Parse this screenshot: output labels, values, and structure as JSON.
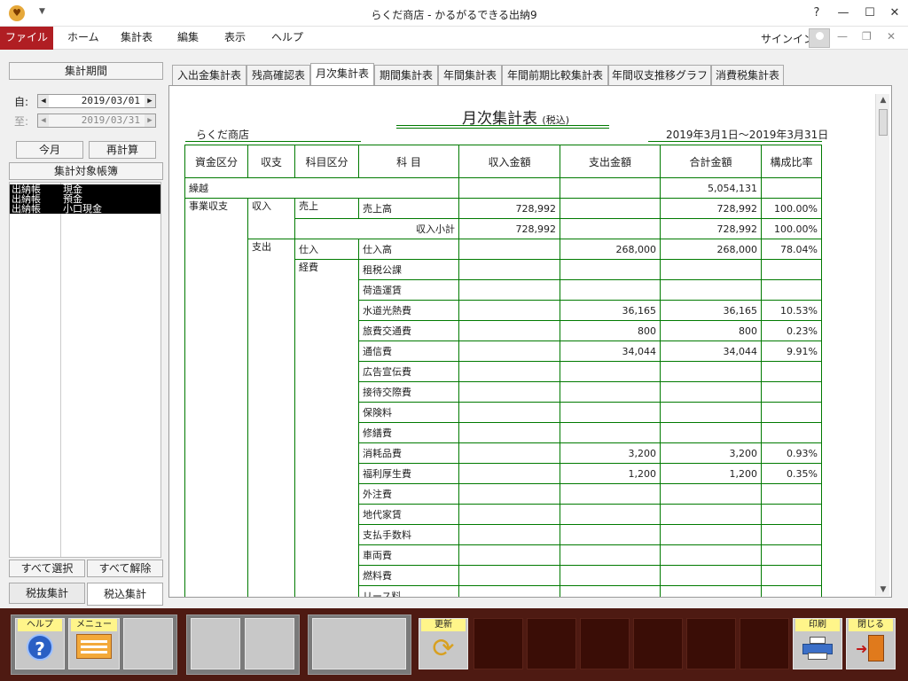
{
  "window": {
    "title": "らくだ商店 - かるがるできる出納9",
    "help_glyph": "?"
  },
  "menu": {
    "items": [
      "ファイル",
      "ホーム",
      "集計表",
      "編集",
      "表示",
      "ヘルプ"
    ],
    "signin": "サインイン"
  },
  "left": {
    "period_header": "集計期間",
    "from_label": "自:",
    "from_date": "2019/03/01",
    "to_label": "至:",
    "to_date": "2019/03/31",
    "this_month": "今月",
    "recalc": "再計算",
    "ledger_header": "集計対象帳簿",
    "ledgers": [
      {
        "book": "出納帳",
        "account": "現金"
      },
      {
        "book": "出納帳",
        "account": "預金"
      },
      {
        "book": "出納帳",
        "account": "小口現金"
      }
    ],
    "select_all": "すべて選択",
    "deselect_all": "すべて解除",
    "tax_excl": "税抜集計",
    "tax_incl": "税込集計"
  },
  "tabs": [
    "入出金集計表",
    "残高確認表",
    "月次集計表",
    "期間集計表",
    "年間集計表",
    "年間前期比較集計表",
    "年間収支推移グラフ",
    "消費税集計表"
  ],
  "report": {
    "title": "月次集計表",
    "title_suffix": "(税込)",
    "shop": "らくだ商店",
    "period": "2019年3月1日～2019年3月31日",
    "headers": [
      "資金区分",
      "収支",
      "科目区分",
      "科 目",
      "収入金額",
      "支出金額",
      "合計金額",
      "構成比率"
    ],
    "carryover_label": "繰越",
    "carryover_total": "5,054,131",
    "fund": "事業収支",
    "income": "収入",
    "expense": "支出",
    "sales_cat": "売上",
    "purchase_cat": "仕入",
    "expense_cat": "経費",
    "subtotal_label": "収入小計",
    "rows": [
      {
        "item": "売上高",
        "in": "728,992",
        "out": "",
        "total": "728,992",
        "ratio": "100.00%"
      },
      {
        "item": "収入小計",
        "in": "728,992",
        "out": "",
        "total": "728,992",
        "ratio": "100.00%"
      },
      {
        "item": "仕入高",
        "in": "",
        "out": "268,000",
        "total": "268,000",
        "ratio": "78.04%"
      },
      {
        "item": "租税公課",
        "in": "",
        "out": "",
        "total": "",
        "ratio": ""
      },
      {
        "item": "荷造運賃",
        "in": "",
        "out": "",
        "total": "",
        "ratio": ""
      },
      {
        "item": "水道光熱費",
        "in": "",
        "out": "36,165",
        "total": "36,165",
        "ratio": "10.53%"
      },
      {
        "item": "旅費交通費",
        "in": "",
        "out": "800",
        "total": "800",
        "ratio": "0.23%"
      },
      {
        "item": "通信費",
        "in": "",
        "out": "34,044",
        "total": "34,044",
        "ratio": "9.91%"
      },
      {
        "item": "広告宣伝費",
        "in": "",
        "out": "",
        "total": "",
        "ratio": ""
      },
      {
        "item": "接待交際費",
        "in": "",
        "out": "",
        "total": "",
        "ratio": ""
      },
      {
        "item": "保険料",
        "in": "",
        "out": "",
        "total": "",
        "ratio": ""
      },
      {
        "item": "修繕費",
        "in": "",
        "out": "",
        "total": "",
        "ratio": ""
      },
      {
        "item": "消耗品費",
        "in": "",
        "out": "3,200",
        "total": "3,200",
        "ratio": "0.93%"
      },
      {
        "item": "福利厚生費",
        "in": "",
        "out": "1,200",
        "total": "1,200",
        "ratio": "0.35%"
      },
      {
        "item": "外注費",
        "in": "",
        "out": "",
        "total": "",
        "ratio": ""
      },
      {
        "item": "地代家賃",
        "in": "",
        "out": "",
        "total": "",
        "ratio": ""
      },
      {
        "item": "支払手数料",
        "in": "",
        "out": "",
        "total": "",
        "ratio": ""
      },
      {
        "item": "車両費",
        "in": "",
        "out": "",
        "total": "",
        "ratio": ""
      },
      {
        "item": "燃料費",
        "in": "",
        "out": "",
        "total": "",
        "ratio": ""
      },
      {
        "item": "リース料",
        "in": "",
        "out": "",
        "total": "",
        "ratio": ""
      }
    ]
  },
  "fkeys": {
    "help": "ヘルプ",
    "menu": "メニュー",
    "refresh": "更新",
    "print": "印刷",
    "close": "閉じる"
  },
  "colors": {
    "menu_file_bg": "#b01e23",
    "grid": "#007a00",
    "bottom_bar": "#4e1a12",
    "fkey_label": "#fff58a"
  }
}
